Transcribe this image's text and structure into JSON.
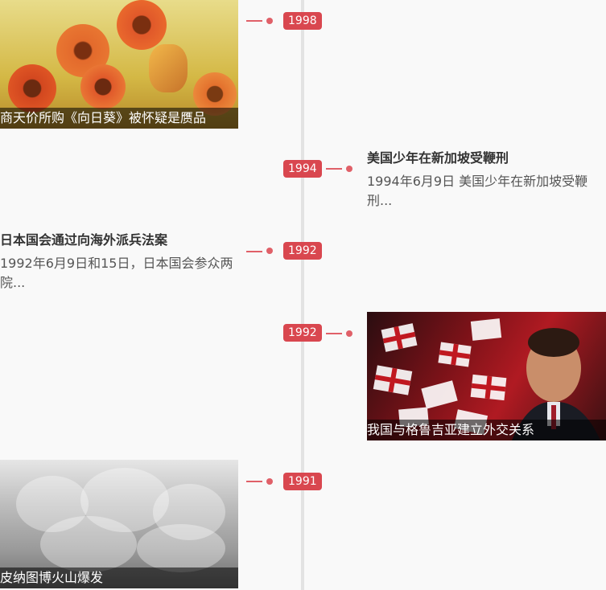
{
  "events": [
    {
      "year": "1998",
      "title": "商天价所购《向日葵》被怀疑是赝品"
    },
    {
      "year": "1994",
      "title": "美国少年在新加坡受鞭刑",
      "summary": "1994年6月9日 美国少年在新加坡受鞭刑..."
    },
    {
      "year": "1992",
      "title": "日本国会通过向海外派兵法案",
      "summary": "1992年6月9日和15日，日本国会参众两院..."
    },
    {
      "year": "1992",
      "title": "我国与格鲁吉亚建立外交关系"
    },
    {
      "year": "1991",
      "title": "皮纳图博火山爆发"
    }
  ],
  "colors": {
    "badge": "#d9474f",
    "axis": "#e3e3e3",
    "connector": "#e06068"
  }
}
